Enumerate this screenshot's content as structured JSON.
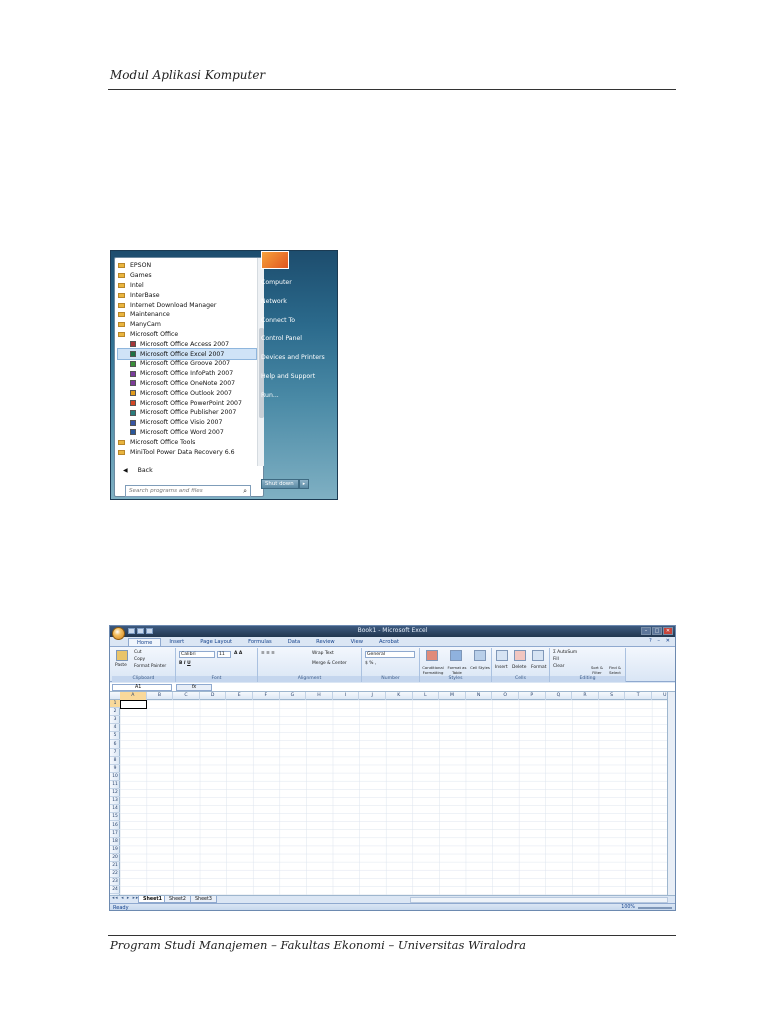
{
  "page": {
    "header": "Modul Aplikasi Komputer",
    "footer": "Program Studi Manajemen – Fakultas Ekonomi – Universitas Wiralodra"
  },
  "start_menu": {
    "programs": [
      {
        "label": "EPSON",
        "type": "folder"
      },
      {
        "label": "Games",
        "type": "folder"
      },
      {
        "label": "Intel",
        "type": "folder"
      },
      {
        "label": "InterBase",
        "type": "folder"
      },
      {
        "label": "Internet Download Manager",
        "type": "folder"
      },
      {
        "label": "Maintenance",
        "type": "folder"
      },
      {
        "label": "ManyCam",
        "type": "folder"
      },
      {
        "label": "Microsoft Office",
        "type": "folder"
      },
      {
        "label": "Microsoft Office Access 2007",
        "type": "app",
        "color": "#a4373a"
      },
      {
        "label": "Microsoft Office Excel 2007",
        "type": "app",
        "color": "#1e7145",
        "highlighted": true
      },
      {
        "label": "Microsoft Office Groove 2007",
        "type": "app",
        "color": "#3a8f3a"
      },
      {
        "label": "Microsoft Office InfoPath 2007",
        "type": "app",
        "color": "#7a3d9c"
      },
      {
        "label": "Microsoft Office OneNote 2007",
        "type": "app",
        "color": "#7d3c98"
      },
      {
        "label": "Microsoft Office Outlook 2007",
        "type": "app",
        "color": "#e09b1c"
      },
      {
        "label": "Microsoft Office PowerPoint 2007",
        "type": "app",
        "color": "#d24726"
      },
      {
        "label": "Microsoft Office Publisher 2007",
        "type": "app",
        "color": "#2a7c7c"
      },
      {
        "label": "Microsoft Office Visio 2007",
        "type": "app",
        "color": "#3955a3"
      },
      {
        "label": "Microsoft Office Word 2007",
        "type": "app",
        "color": "#2b579a"
      },
      {
        "label": "Microsoft Office Tools",
        "type": "folder"
      },
      {
        "label": "MiniTool Power Data Recovery 6.6",
        "type": "folder"
      }
    ],
    "back_label": "Back",
    "search_placeholder": "Search programs and files",
    "right_items": [
      "Computer",
      "Network",
      "Connect To",
      "Control Panel",
      "Devices and Printers",
      "Help and Support",
      "Run..."
    ],
    "shutdown_label": "Shut down"
  },
  "excel": {
    "window_title": "Book1 - Microsoft Excel",
    "tabs": [
      "Home",
      "Insert",
      "Page Layout",
      "Formulas",
      "Data",
      "Review",
      "View",
      "Acrobat"
    ],
    "ribbon": {
      "clipboard": {
        "paste": "Paste",
        "cut": "Cut",
        "copy": "Copy",
        "format_painter": "Format Painter",
        "label": "Clipboard"
      },
      "font": {
        "name": "Calibri",
        "size": "11",
        "label": "Font"
      },
      "alignment": {
        "wrap": "Wrap Text",
        "merge": "Merge & Center",
        "label": "Alignment"
      },
      "number": {
        "format": "General",
        "label": "Number"
      },
      "styles": {
        "conditional": "Conditional Formatting",
        "format_table": "Format as Table",
        "cell_styles": "Cell Styles",
        "label": "Styles"
      },
      "cells": {
        "insert": "Insert",
        "delete": "Delete",
        "format": "Format",
        "label": "Cells"
      },
      "editing": {
        "autosum": "AutoSum",
        "fill": "Fill",
        "clear": "Clear",
        "sort": "Sort & Filter",
        "find": "Find & Select",
        "label": "Editing"
      }
    },
    "name_box": "A1",
    "fx_label": "fx",
    "columns": [
      "A",
      "B",
      "C",
      "D",
      "E",
      "F",
      "G",
      "H",
      "I",
      "J",
      "K",
      "L",
      "M",
      "N",
      "O",
      "P",
      "Q",
      "R",
      "S",
      "T",
      "U"
    ],
    "rows": [
      "1",
      "2",
      "3",
      "4",
      "5",
      "6",
      "7",
      "8",
      "9",
      "10",
      "11",
      "12",
      "13",
      "14",
      "15",
      "16",
      "17",
      "18",
      "19",
      "20",
      "21",
      "22",
      "23",
      "24"
    ],
    "sheet_nav": "◂◂ ◂ ▸ ▸▸",
    "sheets": [
      "Sheet1",
      "Sheet2",
      "Sheet3"
    ],
    "status": "Ready",
    "zoom": "100%"
  }
}
